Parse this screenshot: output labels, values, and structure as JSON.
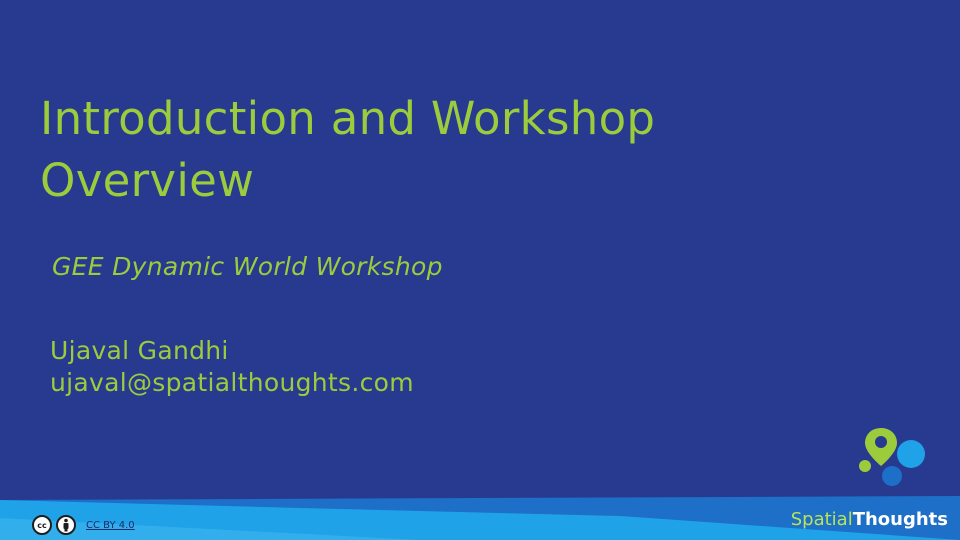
{
  "slide": {
    "title_line1": "Introduction and Workshop",
    "title_line2": "Overview",
    "subtitle": "GEE Dynamic World Workshop",
    "author_name": "Ujaval Gandhi",
    "author_email": "ujaval@spatialthoughts.com"
  },
  "footer": {
    "cc_label": "cc",
    "license_link": "CC BY 4.0",
    "brand_part1": "Spatial",
    "brand_part2": "Thoughts"
  },
  "colors": {
    "background": "#283a8f",
    "accent_green": "#9ccc3c",
    "band_light": "#1fa2e8",
    "band_dark": "#1d6fc7"
  },
  "icons": [
    "cc-icon",
    "by-person-icon",
    "location-pin-icon"
  ]
}
